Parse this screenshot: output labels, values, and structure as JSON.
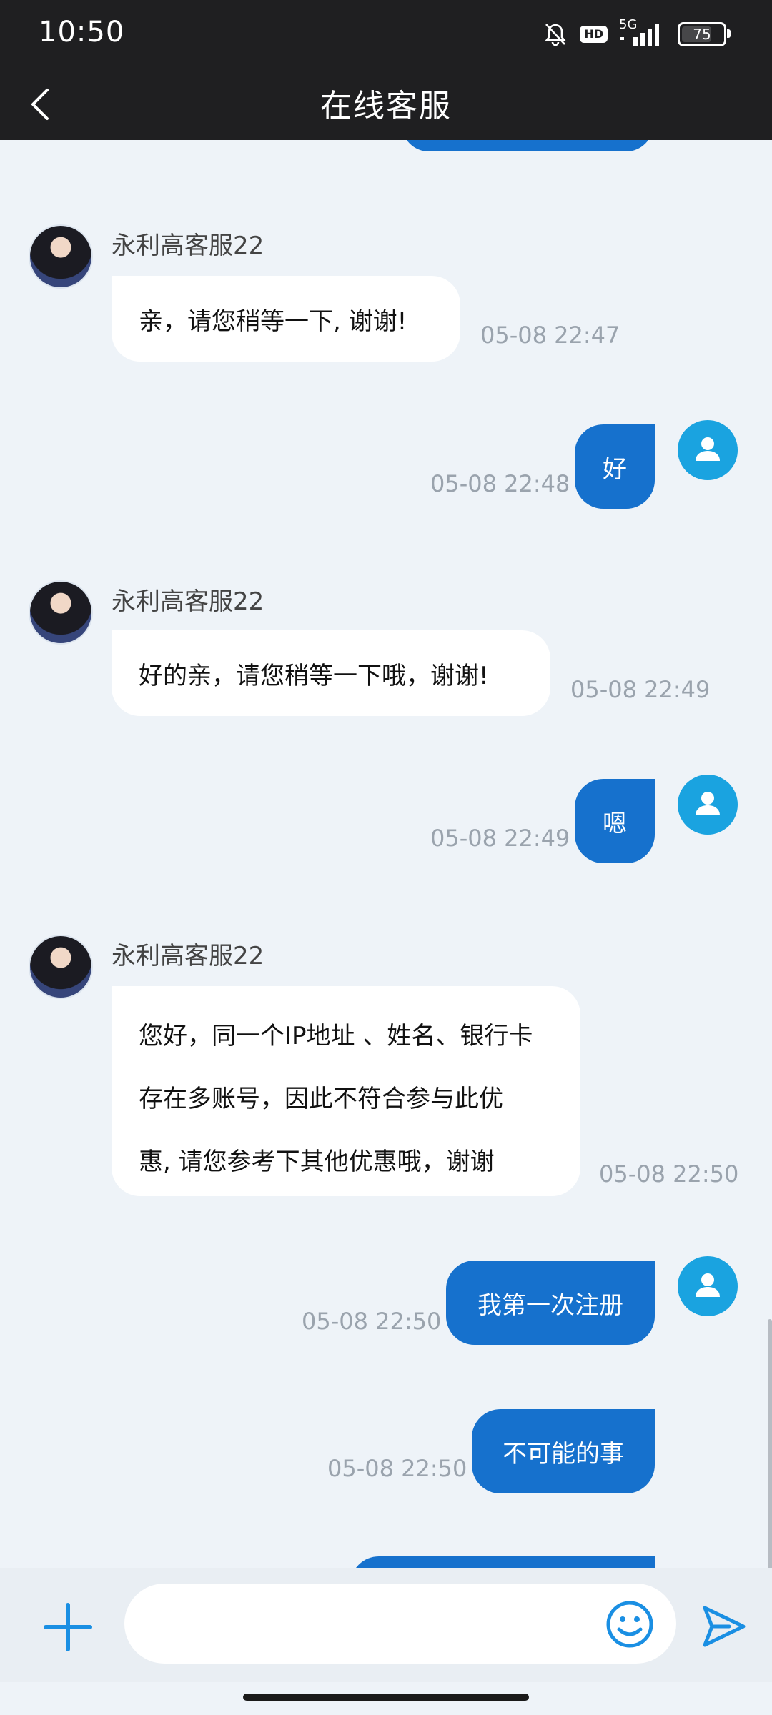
{
  "status_bar": {
    "time": "10:50",
    "hd": "HD",
    "network": "5G",
    "battery": "75",
    "battery_level": 0.75
  },
  "header": {
    "title": "在线客服"
  },
  "messages": [
    {
      "sender": "agent",
      "name": "永利高客服22",
      "lines": [
        "亲，请您稍等一下, 谢谢!"
      ],
      "time": "05-08 22:47"
    },
    {
      "sender": "user",
      "text": "好",
      "time": "05-08 22:48"
    },
    {
      "sender": "agent",
      "name": "永利高客服22",
      "lines": [
        "好的亲，请您稍等一下哦，谢谢!"
      ],
      "time": "05-08 22:49"
    },
    {
      "sender": "user",
      "text": "嗯",
      "time": "05-08 22:49"
    },
    {
      "sender": "agent",
      "name": "永利高客服22",
      "lines": [
        "您好，同一个IP地址 、姓名、银行卡",
        "存在多账号，因此不符合参与此优",
        "惠, 请您参考下其他优惠哦，谢谢"
      ],
      "time": "05-08 22:50"
    },
    {
      "sender": "user",
      "text": "我第一次注册",
      "time": "05-08 22:50"
    },
    {
      "sender": "user",
      "text": "不可能的事",
      "time": "05-08 22:50"
    }
  ],
  "input": {
    "placeholder": ""
  },
  "colors": {
    "user_bubble": "#1671cd",
    "header_bg": "#1f1f21",
    "chat_bg": "#eef3f8",
    "user_avatar": "#1aa3e0",
    "accent": "#1a8fe3"
  },
  "icons": {
    "back": "chevron-left-icon",
    "plus": "plus-icon",
    "emoji": "smiley-icon",
    "send": "send-icon",
    "user_avatar": "person-icon"
  }
}
